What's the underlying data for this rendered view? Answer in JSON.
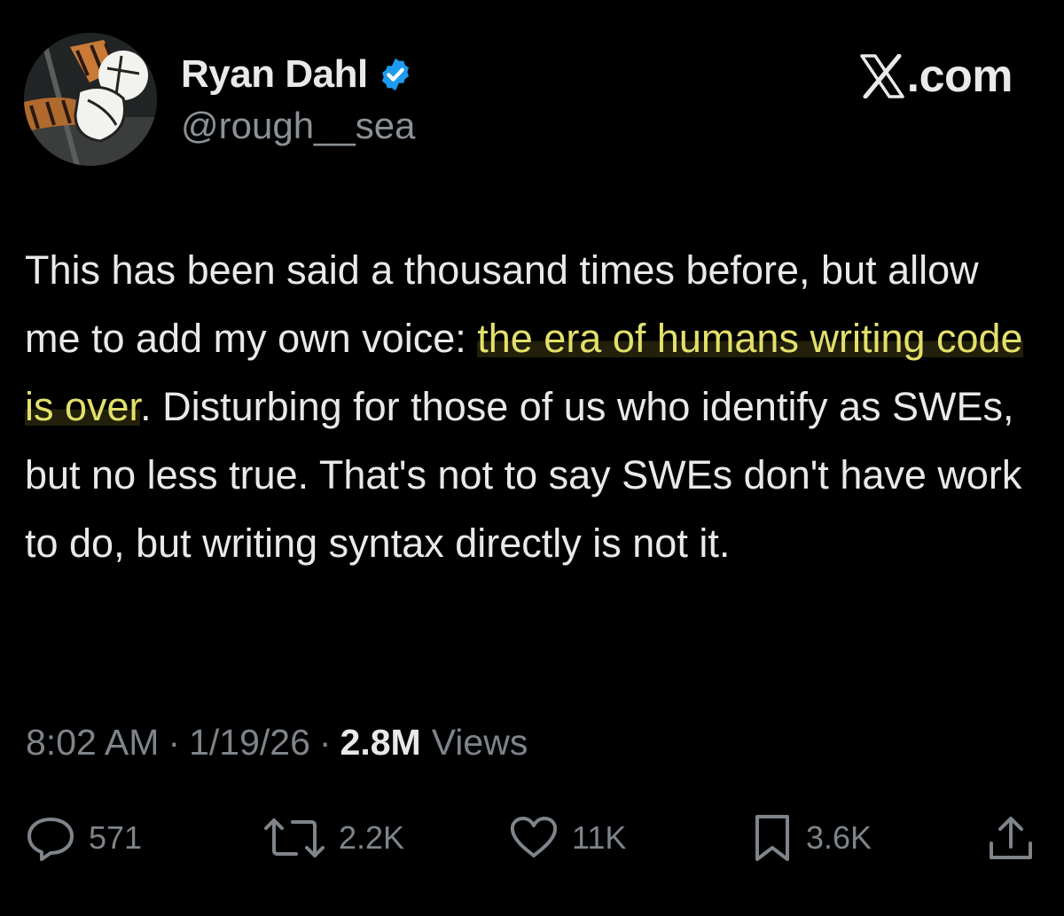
{
  "author": {
    "display_name": "Ryan Dahl",
    "handle": "@rough__sea",
    "verified_icon": "verified-badge-icon",
    "avatar": "avatar-illustration"
  },
  "brand": {
    "icon": "x-logo-icon",
    "domain_text": ".com"
  },
  "tweet": {
    "segment_1": "This has been said a thousand times before, but allow me to add my own voice: ",
    "highlighted": "the era of humans writing code is over",
    "segment_2": ". Disturbing for those of us who identify as SWEs, but no less true. That's not to say SWEs don't have work to do, but writing syntax directly is not it."
  },
  "meta": {
    "time": "8:02 AM",
    "separator": "·",
    "date": "1/19/26",
    "views_count": "2.8M",
    "views_label": "Views"
  },
  "actions": {
    "replies": "571",
    "reposts": "2.2K",
    "likes": "11K",
    "bookmarks": "3.6K"
  },
  "colors": {
    "background": "#000000",
    "text": "#e7e9ea",
    "secondary": "#7e848a",
    "highlight_text": "#e2e06a",
    "verified": "#1d9bf0"
  }
}
